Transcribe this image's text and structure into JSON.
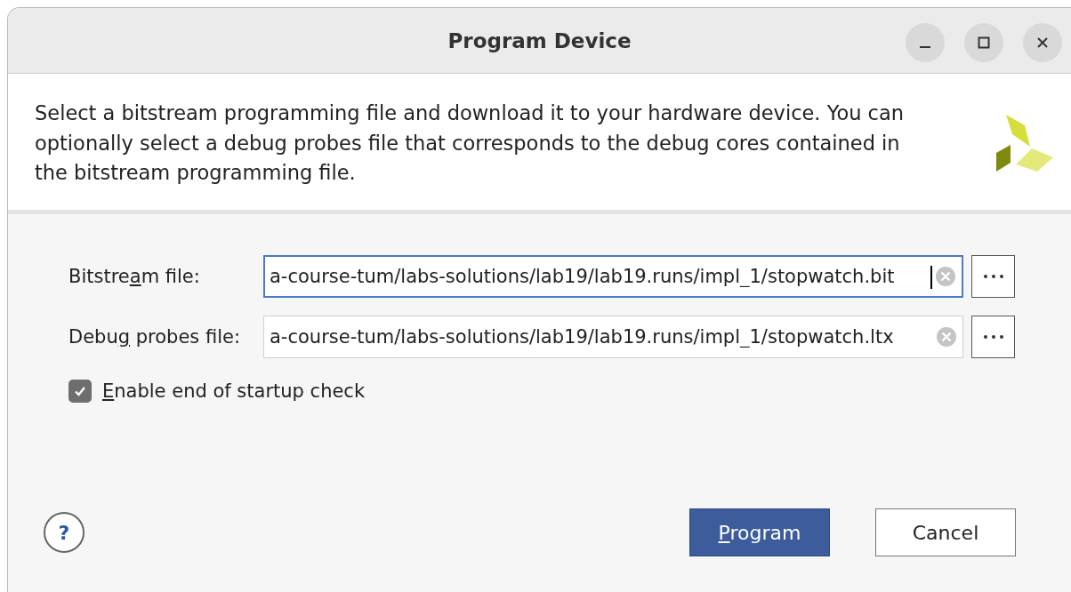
{
  "window": {
    "title": "Program Device"
  },
  "description": "Select a bitstream programming file and download it to your hardware device. You can optionally select a debug probes file that corresponds to the debug cores contained in the bitstream programming file.",
  "fields": [
    {
      "label": {
        "pre": "Bitstre",
        "key": "a",
        "post": "m file:"
      },
      "value": "a-course-tum/labs-solutions/lab19/lab19.runs/impl_1/stopwatch.bit",
      "focused": true
    },
    {
      "label": {
        "pre": "Debu",
        "key": "g",
        "post": " probes file:"
      },
      "value": "a-course-tum/labs-solutions/lab19/lab19.runs/impl_1/stopwatch.ltx",
      "focused": false
    }
  ],
  "checkbox": {
    "label": {
      "key": "E",
      "post": "nable end of startup check"
    },
    "checked": true
  },
  "help": "?",
  "buttons": [
    {
      "label": {
        "key": "P",
        "post": "rogram"
      },
      "kind": "primary"
    },
    {
      "label": {
        "pre": "Cancel"
      },
      "kind": "secondary"
    }
  ]
}
